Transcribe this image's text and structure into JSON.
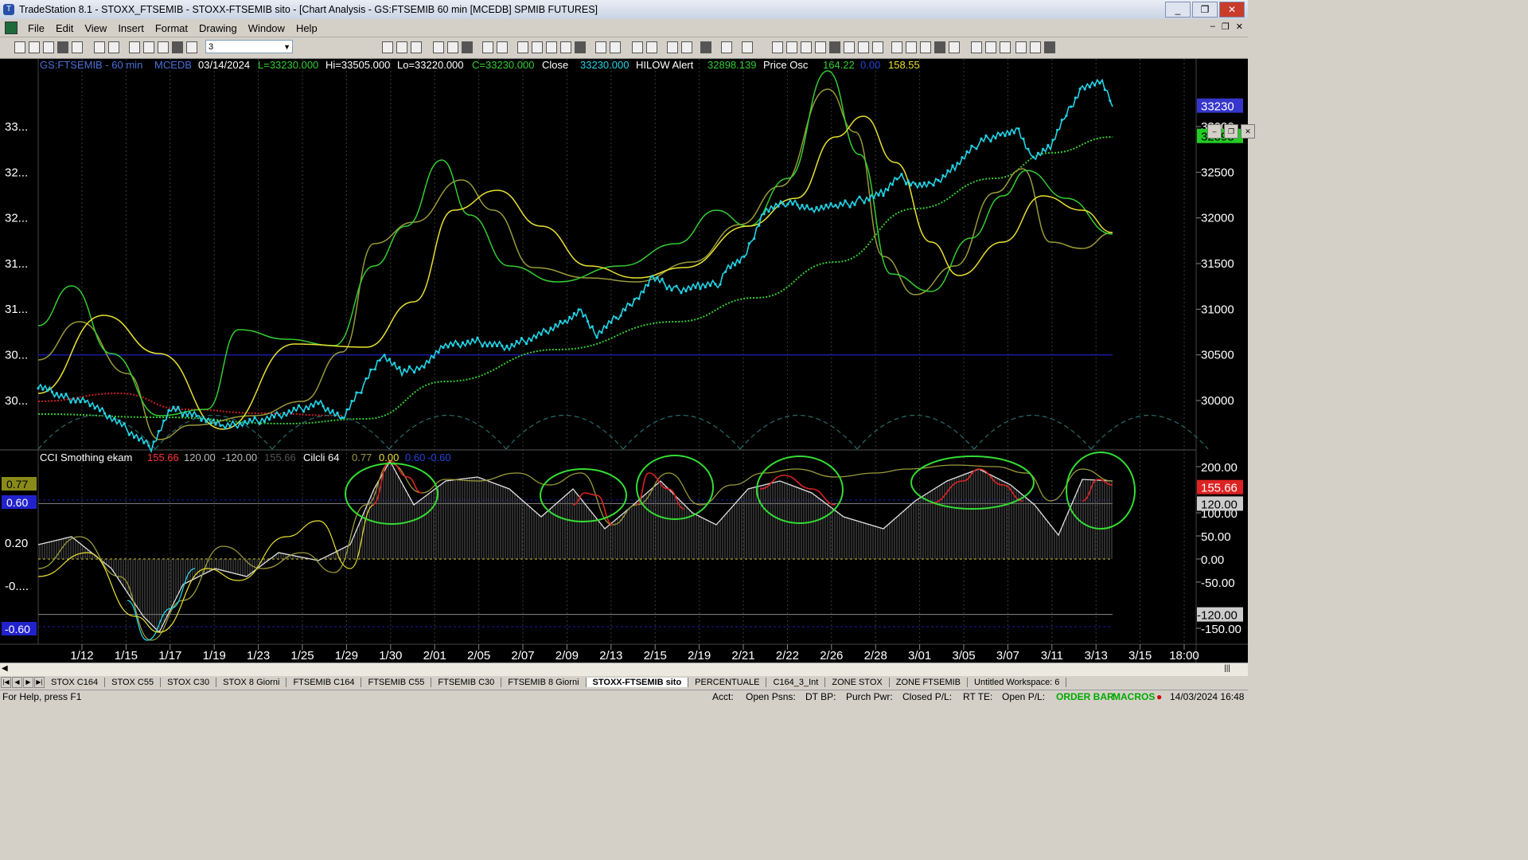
{
  "window": {
    "title": "TradeStation 8.1 - STOXX_FTSEMIB - STOXX-FTSEMIB sito - [Chart Analysis - GS:FTSEMIB  60 min  [MCEDB] SPMIB FUTURES]",
    "min": "_",
    "max": "❐",
    "close": "✕"
  },
  "menu": [
    "File",
    "Edit",
    "View",
    "Insert",
    "Format",
    "Drawing",
    "Window",
    "Help"
  ],
  "mdi": {
    "min": "–",
    "restore": "❐",
    "close": "✕"
  },
  "toolbar": {
    "combo_value": "3"
  },
  "header": {
    "symbol": "GS:FTSEMIB - 60 min",
    "feed": "MCEDB",
    "date": "03/14/2024",
    "last": "L=33230.000",
    "hi": "Hi=33505.000",
    "lo": "Lo=33220.000",
    "close_val": "C=33230.000",
    "close_lbl": "Close",
    "close_num": "33230.000",
    "hilow_lbl": "HILOW Alert",
    "hilow_num": "32898.139",
    "posc_lbl": "Price Osc",
    "posc_1": "164.22",
    "posc_2": "0.00",
    "posc_3": "158.55"
  },
  "sub_header": {
    "cci_lbl": "CCI Smothing ekam",
    "cci_1": "155.66",
    "cci_2": "120.00",
    "cci_3": "-120.00",
    "cci_4": "155.66",
    "cicli_lbl": "Cilcli 64",
    "cicli_1": "0.77",
    "cicli_2": "0.00",
    "cicli_3": "0.60",
    "cicli_4": "-0.60"
  },
  "price_axis": [
    "33000",
    "32500",
    "32000",
    "31500",
    "31000",
    "30500",
    "30000"
  ],
  "left_price_axis": [
    "33...",
    "32...",
    "32...",
    "31...",
    "31...",
    "30...",
    "30..."
  ],
  "price_tags": {
    "last": "33230",
    "hilow": "32898"
  },
  "osc_axis": [
    "200.00",
    "100.00",
    "50.00",
    "0.00",
    "-50.00",
    "-150.00"
  ],
  "osc_tags": {
    "cci": "155.66",
    "upper": "120.00",
    "lower": "-120.00"
  },
  "left_osc_axis": [
    "0.20",
    "-0...."
  ],
  "left_osc_tags": {
    "top": "0.77",
    "mid": "0.60",
    "bot": "-0.60"
  },
  "date_axis": [
    "1/12",
    "1/15",
    "1/17",
    "1/19",
    "1/23",
    "1/25",
    "1/29",
    "1/30",
    "2/01",
    "2/05",
    "2/07",
    "2/09",
    "2/13",
    "2/15",
    "2/19",
    "2/21",
    "2/22",
    "2/26",
    "2/28",
    "3/01",
    "3/05",
    "3/07",
    "3/11",
    "3/13",
    "3/15",
    "18:00"
  ],
  "tabs": [
    "STOX C164",
    "STOX C55",
    "STOX C30",
    "STOX 8 Giorni",
    "FTSEMIB C164",
    "FTSEMIB C55",
    "FTSEMIB C30",
    "FTSEMIB 8 Giorni",
    "STOXX-FTSEMIB sito",
    "PERCENTUALE",
    "C164_3_Int",
    "ZONE STOX",
    "ZONE FTSEMIB",
    "Untitled Workspace: 6"
  ],
  "active_tab": "STOXX-FTSEMIB sito",
  "status": {
    "help": "For Help, press F1",
    "acct": "Acct:",
    "open_psns": "Open Psns:",
    "dt_bp": "DT BP:",
    "purch_pwr": "Purch Pwr:",
    "closed_pl": "Closed P/L:",
    "rt_te": "RT TE:",
    "open_pl": "Open P/L:",
    "order_bar": "ORDER BAR",
    "macros": "MACROS",
    "datetime": "14/03/2024 16:48"
  },
  "colors": {
    "price": "#22d3e6",
    "ma_green": "#33cc33",
    "ma_yellow": "#e8e030",
    "ma_olive": "#9a9a3a",
    "ma_red": "#cc2020",
    "hline_blue": "#1a1aaa",
    "circle": "#33dd33"
  }
}
